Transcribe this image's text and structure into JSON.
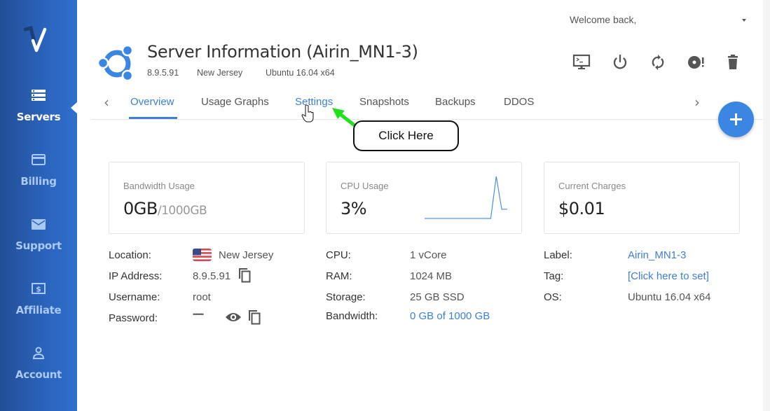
{
  "sidebar": {
    "logo": "vultr-logo",
    "items": [
      {
        "label": "Servers",
        "icon": "server-stack-icon",
        "active": true
      },
      {
        "label": "Billing",
        "icon": "credit-card-icon",
        "active": false
      },
      {
        "label": "Support",
        "icon": "envelope-icon",
        "active": false
      },
      {
        "label": "Affiliate",
        "icon": "dollar-bill-icon",
        "active": false
      },
      {
        "label": "Account",
        "icon": "user-icon",
        "active": false
      }
    ]
  },
  "header": {
    "welcome": "Welcome back,",
    "title": "Server Information (Airin_MN1-3)",
    "ip": "8.9.5.91",
    "location": "New Jersey",
    "os": "Ubuntu 16.04 x64",
    "actions": [
      {
        "name": "console",
        "icon": "console-icon"
      },
      {
        "name": "power",
        "icon": "power-icon"
      },
      {
        "name": "restart",
        "icon": "restart-icon"
      },
      {
        "name": "reinstall",
        "icon": "disc-alert-icon"
      },
      {
        "name": "destroy",
        "icon": "trash-icon"
      }
    ]
  },
  "tabs": [
    {
      "label": "Overview",
      "active": true
    },
    {
      "label": "Usage Graphs",
      "active": false
    },
    {
      "label": "Settings",
      "active": false
    },
    {
      "label": "Snapshots",
      "active": false
    },
    {
      "label": "Backups",
      "active": false
    },
    {
      "label": "DDOS",
      "active": false
    }
  ],
  "annotation": {
    "callout": "Click Here",
    "arrow_color": "#22e01f"
  },
  "cards": {
    "bandwidth": {
      "label": "Bandwidth Usage",
      "value": "0GB",
      "sub": "/1000GB"
    },
    "cpu": {
      "label": "CPU Usage",
      "value": "3%",
      "sparkline": [
        0,
        0,
        0,
        0,
        0,
        0,
        0,
        0,
        0,
        0,
        0,
        0,
        0,
        100,
        22,
        22
      ]
    },
    "charges": {
      "label": "Current Charges",
      "value": "$0.01"
    }
  },
  "details": {
    "col1": [
      {
        "label": "Location:",
        "value": "New Jersey"
      },
      {
        "label": "IP Address:",
        "value": "8.9.5.91"
      },
      {
        "label": "Username:",
        "value": "root"
      },
      {
        "label": "Password:",
        "value": "•••••••"
      }
    ],
    "col2": [
      {
        "label": "CPU:",
        "value": "1 vCore"
      },
      {
        "label": "RAM:",
        "value": "1024 MB"
      },
      {
        "label": "Storage:",
        "value": "25 GB SSD"
      },
      {
        "label": "Bandwidth:",
        "value": "0 GB of 1000 GB"
      }
    ],
    "col3": [
      {
        "label": "Label:",
        "value": "Airin_MN1-3"
      },
      {
        "label": "Tag:",
        "value": "[Click here to set]"
      },
      {
        "label": "OS:",
        "value": "Ubuntu 16.04 x64"
      }
    ]
  },
  "colors": {
    "accent": "#3d7fd8",
    "sidebar": "#2b64bd",
    "fab": "#3a86e2"
  }
}
